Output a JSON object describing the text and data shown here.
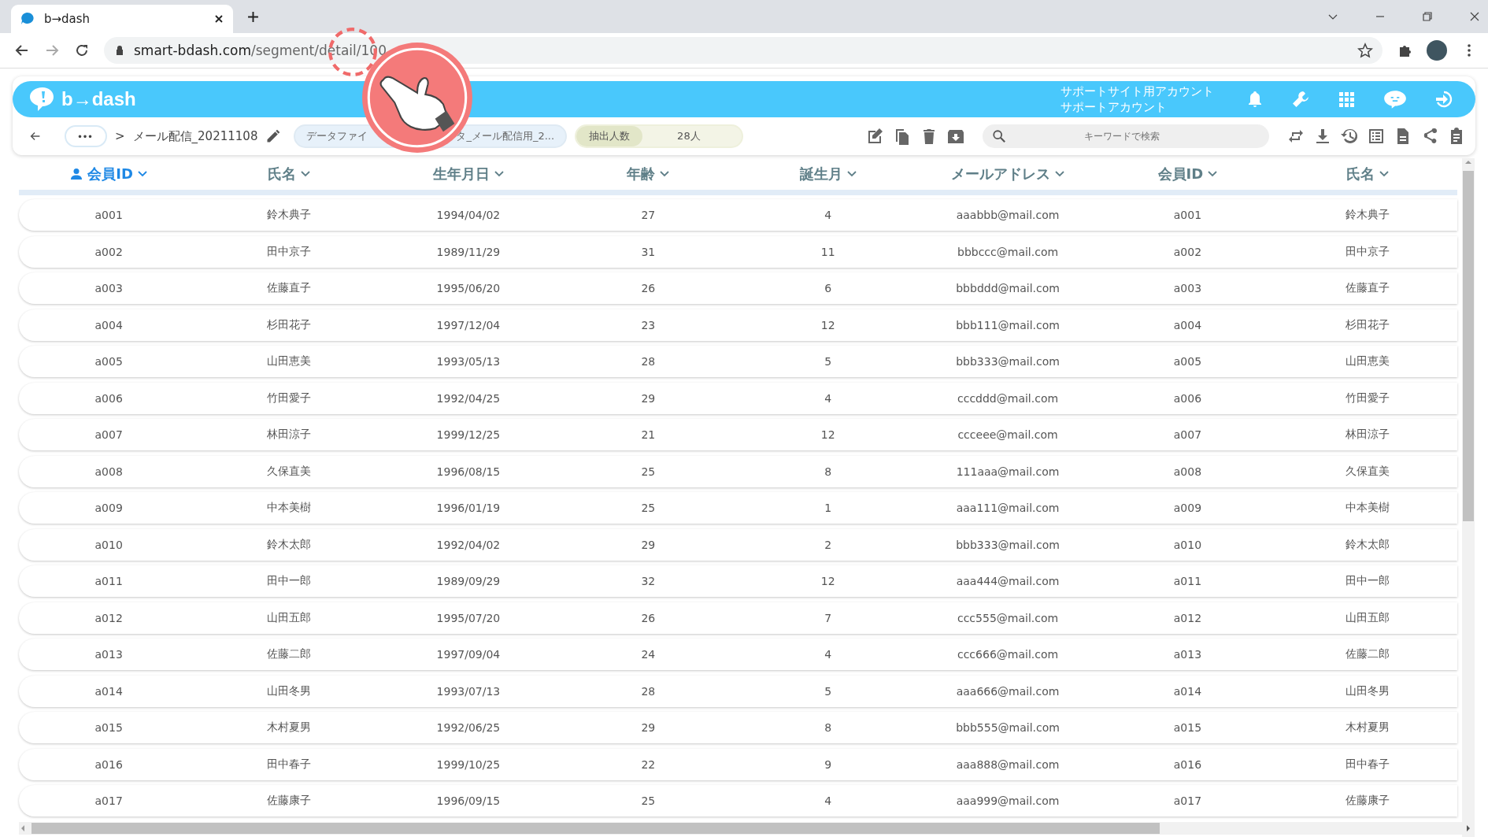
{
  "browser": {
    "tab_title": "b→dash",
    "url_host": "smart-bdash.com",
    "url_path": "/segment/detail/100"
  },
  "header": {
    "logo": "b→dash",
    "account_lines": [
      "サポートサイト用アカウント",
      "サポートアカウント"
    ]
  },
  "toolbar": {
    "more": "•••",
    "separator": ">",
    "segment_name": "メール配信_20211108",
    "data_file_chip": [
      "データファイ",
      "タ_メール配信用_2..."
    ],
    "count_label": "抽出人数",
    "count_value": "28人",
    "search": {
      "placeholder": "キーワードで検索"
    }
  },
  "table": {
    "columns": [
      {
        "label": "会員ID",
        "key": true
      },
      {
        "label": "氏名",
        "key": false
      },
      {
        "label": "生年月日",
        "key": false
      },
      {
        "label": "年齢",
        "key": false
      },
      {
        "label": "誕生月",
        "key": false
      },
      {
        "label": "メールアドレス",
        "key": false
      },
      {
        "label": "会員ID",
        "key": false
      },
      {
        "label": "氏名",
        "key": false
      }
    ],
    "rows": [
      [
        "a001",
        "鈴木典子",
        "1994/04/02",
        "27",
        "4",
        "aaabbb@mail.com",
        "a001",
        "鈴木典子"
      ],
      [
        "a002",
        "田中京子",
        "1989/11/29",
        "31",
        "11",
        "bbbccc@mail.com",
        "a002",
        "田中京子"
      ],
      [
        "a003",
        "佐藤直子",
        "1995/06/20",
        "26",
        "6",
        "bbbddd@mail.com",
        "a003",
        "佐藤直子"
      ],
      [
        "a004",
        "杉田花子",
        "1997/12/04",
        "23",
        "12",
        "bbb111@mail.com",
        "a004",
        "杉田花子"
      ],
      [
        "a005",
        "山田恵美",
        "1993/05/13",
        "28",
        "5",
        "bbb333@mail.com",
        "a005",
        "山田恵美"
      ],
      [
        "a006",
        "竹田愛子",
        "1992/04/25",
        "29",
        "4",
        "cccddd@mail.com",
        "a006",
        "竹田愛子"
      ],
      [
        "a007",
        "林田涼子",
        "1999/12/25",
        "21",
        "12",
        "ccceee@mail.com",
        "a007",
        "林田涼子"
      ],
      [
        "a008",
        "久保直美",
        "1996/08/15",
        "25",
        "8",
        "111aaa@mail.com",
        "a008",
        "久保直美"
      ],
      [
        "a009",
        "中本美樹",
        "1996/01/19",
        "25",
        "1",
        "aaa111@mail.com",
        "a009",
        "中本美樹"
      ],
      [
        "a010",
        "鈴木太郎",
        "1992/04/02",
        "29",
        "2",
        "bbb333@mail.com",
        "a010",
        "鈴木太郎"
      ],
      [
        "a011",
        "田中一郎",
        "1989/09/29",
        "32",
        "12",
        "aaa444@mail.com",
        "a011",
        "田中一郎"
      ],
      [
        "a012",
        "山田五郎",
        "1995/07/20",
        "26",
        "7",
        "ccc555@mail.com",
        "a012",
        "山田五郎"
      ],
      [
        "a013",
        "佐藤二郎",
        "1997/09/04",
        "24",
        "4",
        "ccc666@mail.com",
        "a013",
        "佐藤二郎"
      ],
      [
        "a014",
        "山田冬男",
        "1993/07/13",
        "28",
        "5",
        "aaa666@mail.com",
        "a014",
        "山田冬男"
      ],
      [
        "a015",
        "木村夏男",
        "1992/06/25",
        "29",
        "8",
        "bbb555@mail.com",
        "a015",
        "木村夏男"
      ],
      [
        "a016",
        "田中春子",
        "1999/10/25",
        "22",
        "9",
        "aaa888@mail.com",
        "a016",
        "田中春子"
      ],
      [
        "a017",
        "佐藤康子",
        "1996/09/15",
        "25",
        "4",
        "aaa999@mail.com",
        "a017",
        "佐藤康子"
      ]
    ]
  }
}
